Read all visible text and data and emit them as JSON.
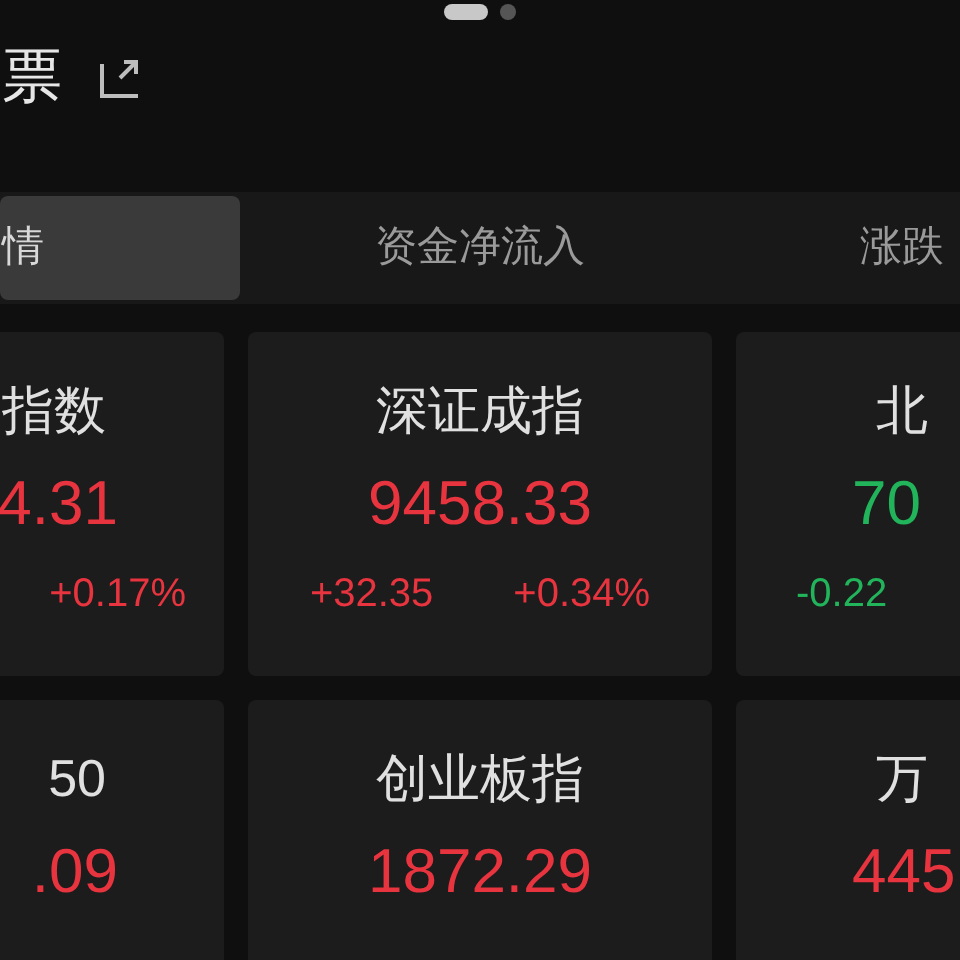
{
  "page_dots": [
    {
      "selected": true
    },
    {
      "selected": false
    }
  ],
  "header": {
    "title": "票"
  },
  "tabs": [
    {
      "label": "情",
      "selected": true
    },
    {
      "label": "资金净流入",
      "selected": false
    },
    {
      "label": "涨跌",
      "selected": false
    }
  ],
  "index_rows": [
    [
      {
        "name": "指数",
        "value": "4.31",
        "change_pct": "+0.17%",
        "color": "#e8343f"
      },
      {
        "name": "深证成指",
        "value": "9458.33",
        "change": "+32.35",
        "change_pct": "+0.34%",
        "color": "#e8343f"
      },
      {
        "name": "北",
        "value": "70",
        "change": "-0.22",
        "color": "#21b45a"
      }
    ],
    [
      {
        "name": "50",
        "value": ".09",
        "color": "#e8343f"
      },
      {
        "name": "创业板指",
        "value": "1872.29",
        "color": "#e8343f"
      },
      {
        "name": "万",
        "value": "445",
        "color": "#e8343f"
      }
    ]
  ]
}
